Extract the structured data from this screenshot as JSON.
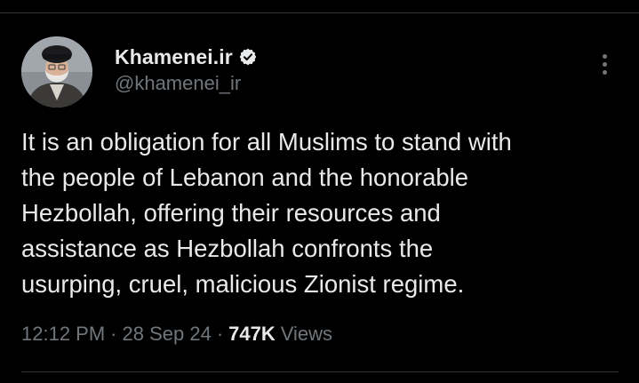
{
  "author": {
    "display_name": "Khamenei.ir",
    "handle": "@khamenei_ir",
    "verified": true,
    "avatar_icon": "profile-photo"
  },
  "tweet": {
    "lines": [
      "It is an obligation for all Muslims to stand with",
      "the people of Lebanon and the honorable",
      "Hezbollah, offering their resources and",
      "assistance as Hezbollah confronts the",
      "usurping, cruel, malicious Zionist regime."
    ]
  },
  "meta": {
    "time": "12:12 PM",
    "separator": "·",
    "date": "28 Sep 24",
    "views_count": "747K",
    "views_label": "Views"
  },
  "colors": {
    "background": "#000000",
    "text": "#e7e9ea",
    "secondary_text": "#71767b",
    "verified_badge": "#e7e9ea",
    "divider": "#2f3336"
  },
  "icons": {
    "verified": "verified-badge-icon",
    "more": "more-options-icon"
  }
}
